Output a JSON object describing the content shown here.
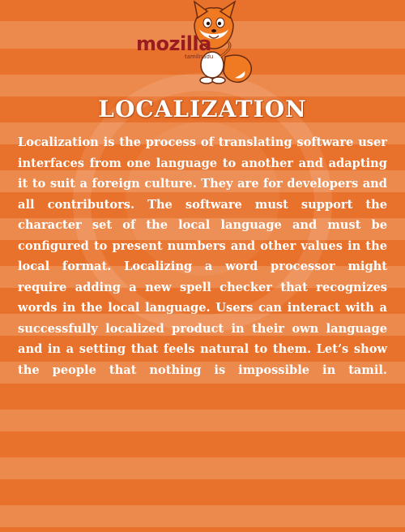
{
  "logo": {
    "text": "mozilla",
    "subtext": "tamilnadu",
    "mascot_icon": "fox-mascot-icon"
  },
  "title": "LOCALIZATION",
  "paragraph": "Localization is the process of translating software user interfaces from one language to another and adapting it to suit a foreign culture. They are for developers and all contributors. The software must support the character set of the local language and must be configured to present numbers and other values in the local format. Localizing a word processor might require adding a new spell checker that recognizes words in the local language.  Users can interact with a successfully localized product in their own language and in a setting that feels natural to them. Let’s show the people that nothing is impossible in tamil.",
  "colors": {
    "background": "#e8712b",
    "stripe": "#ec8a4e",
    "text": "#ffffff",
    "logo_text": "#9b1c1f"
  }
}
